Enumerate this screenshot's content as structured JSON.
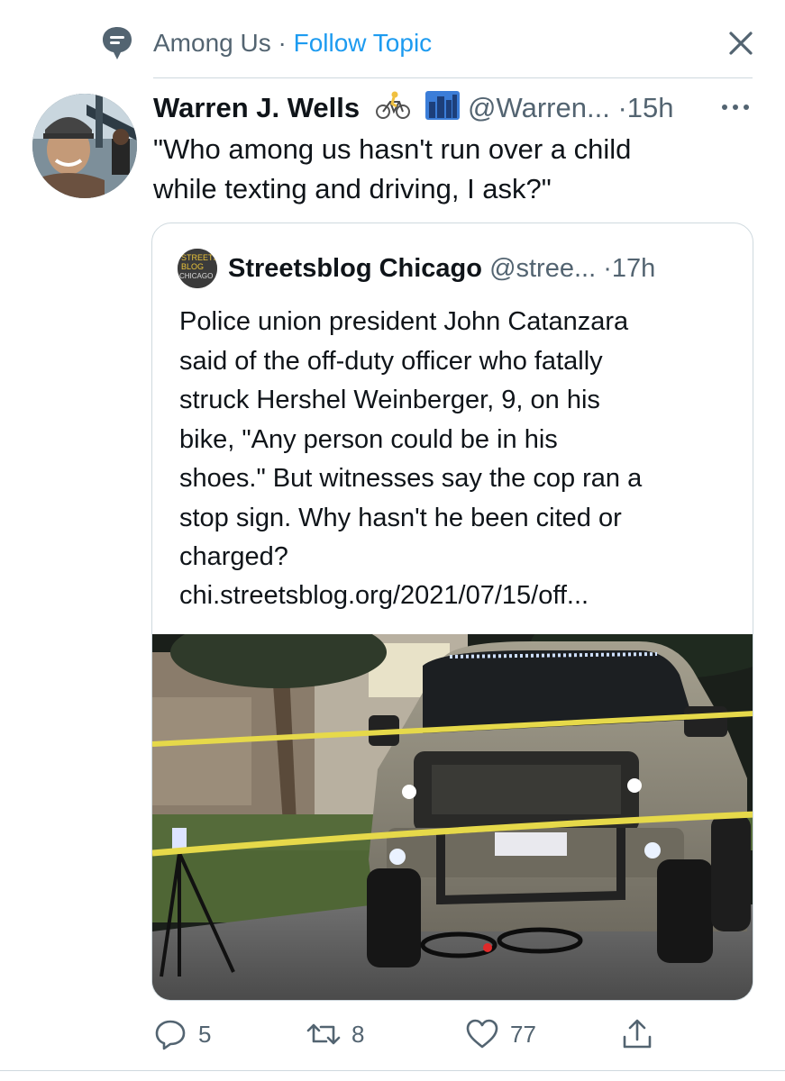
{
  "topic": {
    "name": "Among Us",
    "separator": "·",
    "follow_label": "Follow Topic"
  },
  "tweet": {
    "author_name": "Warren J. Wells",
    "emojis": [
      "bicyclist-icon",
      "cityscape-icon"
    ],
    "handle": "@Warren...",
    "separator": "·",
    "time": "15h",
    "text": "\"Who among us hasn't run over a child\nwhile texting and driving, I ask?\""
  },
  "quoted_tweet": {
    "avatar_text": [
      "STREETS",
      "BLOG",
      "CHICAGO"
    ],
    "author_name": "Streetsblog Chicago",
    "handle": "@stree...",
    "separator": "·",
    "time": "17h",
    "text": "Police union president John Catanzara\nsaid of the off-duty officer who fatally\nstruck Hershel Weinberger, 9, on his\nbike, \"Any person could be in his\nshoes.\" But witnesses say the cop ran a\nstop sign. Why hasn't he been cited or\ncharged?",
    "link": "chi.streetsblog.org/2021/07/15/off..."
  },
  "actions": {
    "replies": "5",
    "retweets": "8",
    "likes": "77"
  },
  "colors": {
    "accent": "#1d9bf0",
    "secondary_text": "#536471",
    "border": "#cfd9de",
    "police_tape": "#e6d94a"
  }
}
